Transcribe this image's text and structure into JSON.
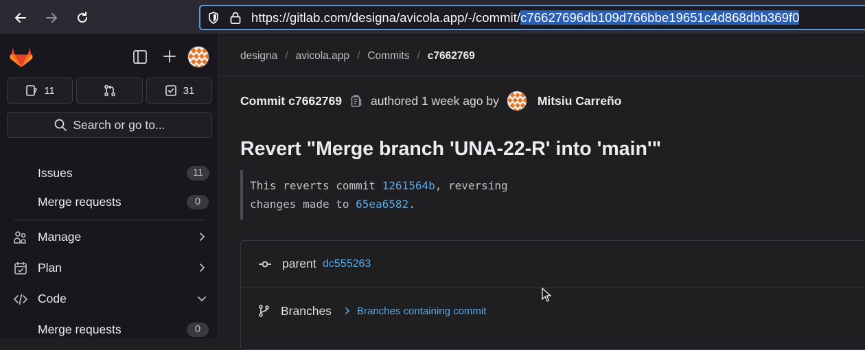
{
  "browser": {
    "url_prefix": "https://gitlab.com/designa/avicola.app/-/commit/",
    "url_selected": "c76627696db109d766bbe19651c4d868dbb369f0"
  },
  "sidebar": {
    "counts": {
      "issues": "11",
      "todos": "31"
    },
    "search_label": "Search or go to...",
    "items": [
      {
        "label": "Issues",
        "badge": "11"
      },
      {
        "label": "Merge requests",
        "badge": "0"
      },
      {
        "label": "Manage"
      },
      {
        "label": "Plan"
      },
      {
        "label": "Code"
      },
      {
        "label": "Merge requests",
        "badge": "0"
      }
    ]
  },
  "breadcrumb": [
    "designa",
    "avicola.app",
    "Commits",
    "c7662769"
  ],
  "commit": {
    "label": "Commit",
    "short_sha": "c7662769",
    "authored_text": "authored 1 week ago by",
    "author": "Mitsiu Carreño",
    "title": "Revert \"Merge branch 'UNA-22-R' into 'main'\"",
    "description": {
      "line1_before": "This reverts commit ",
      "line1_link": "1261564b",
      "line1_after": ", reversing",
      "line2_before": "changes made to ",
      "line2_link": "65ea6582",
      "line2_after": "."
    },
    "parent_label": "parent",
    "parent_sha": "dc555263",
    "branches_label": "Branches",
    "branches_link": "Branches containing commit"
  },
  "colors": {
    "accent_link": "#5aa8e6",
    "url_selection": "#2a5fb7",
    "gitlab_orange": "#fc6d26"
  }
}
